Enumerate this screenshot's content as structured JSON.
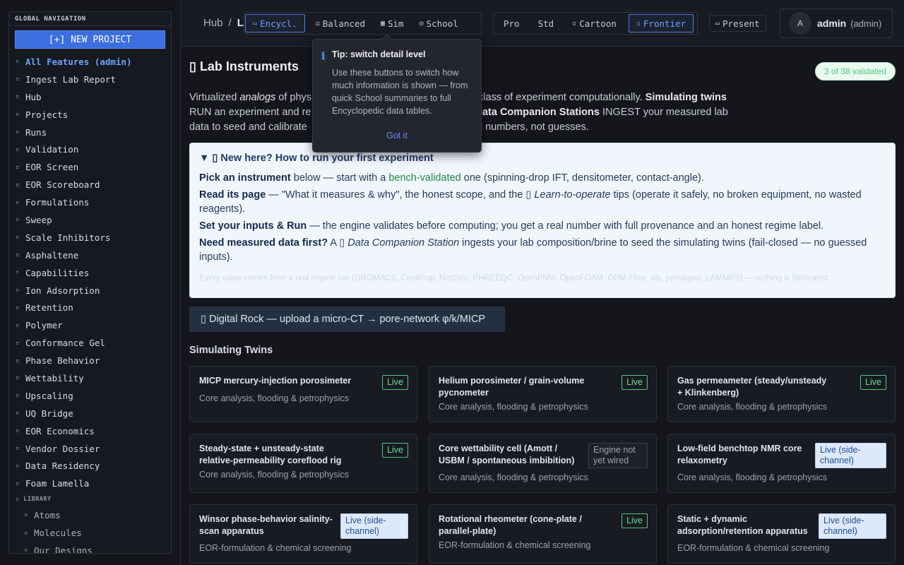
{
  "sidebar": {
    "title": "GLOBAL NAVIGATION",
    "new_project": "[+] NEW PROJECT",
    "items": [
      {
        "bullet": "▫",
        "label": "All Features (admin)"
      },
      {
        "bullet": "▫",
        "label": "Ingest Lab Report"
      },
      {
        "bullet": "▫",
        "label": "Hub"
      },
      {
        "bullet": "▫",
        "label": "Projects"
      },
      {
        "bullet": "▫",
        "label": "Runs"
      },
      {
        "bullet": "▫",
        "label": "Validation"
      },
      {
        "bullet": "▫",
        "label": "EOR Screen"
      },
      {
        "bullet": "▫",
        "label": "EOR Scoreboard"
      },
      {
        "bullet": "▫",
        "label": "Formulations"
      },
      {
        "bullet": "▫",
        "label": "Sweep"
      },
      {
        "bullet": "▫",
        "label": "Scale Inhibitors"
      },
      {
        "bullet": "▫",
        "label": "Asphaltene"
      },
      {
        "bullet": "⚡",
        "label": "Capabilities"
      },
      {
        "bullet": "▫",
        "label": "Ion Adsorption"
      },
      {
        "bullet": "▫",
        "label": "Retention"
      },
      {
        "bullet": "▫",
        "label": "Polymer"
      },
      {
        "bullet": "▫",
        "label": "Conformance Gel"
      },
      {
        "bullet": "▫",
        "label": "Phase Behavior"
      },
      {
        "bullet": "▫",
        "label": "Wettability"
      },
      {
        "bullet": "▫",
        "label": "Upscaling"
      },
      {
        "bullet": "▫",
        "label": "UQ Bridge"
      },
      {
        "bullet": "▫",
        "label": "EOR Economics"
      },
      {
        "bullet": "▫",
        "label": "Vendor Dossier"
      },
      {
        "bullet": "▫",
        "label": "Data Residency"
      },
      {
        "bullet": "▫",
        "label": "Foam Lamella"
      }
    ],
    "library_title": "▫ LIBRARY",
    "library_items": [
      {
        "bullet": "⚛",
        "label": "Atoms"
      },
      {
        "bullet": "▫",
        "label": "Molecules"
      },
      {
        "bullet": "▫",
        "label": "Our Designs"
      }
    ]
  },
  "topbar": {
    "breadcrumb_root": "Hub",
    "breadcrumb_sep": "/",
    "breadcrumb_current": "L",
    "detail_levels": [
      {
        "icon": "▭",
        "label": "Encycl."
      },
      {
        "icon": "⚖",
        "label": "Balanced"
      },
      {
        "icon": "▦",
        "label": "Sim"
      },
      {
        "icon": "◎",
        "label": "School"
      }
    ],
    "styles": [
      {
        "icon": "",
        "label": "Pro"
      },
      {
        "icon": "",
        "label": "Std"
      },
      {
        "icon": "▫",
        "label": "Cartoon"
      },
      {
        "icon": "▫",
        "label": "Frontier"
      }
    ],
    "present": "Present",
    "avatar_letter": "A",
    "user_name": "admin",
    "user_role": "(admin)"
  },
  "tooltip": {
    "icon": "ℹ",
    "title": "Tip: switch detail level",
    "body": "Use these buttons to switch how much information is shown — from quick School summaries to full Encyclopedic data tables.",
    "button": "Got it"
  },
  "main": {
    "title": "▯ Lab Instruments",
    "validated": "3 of 38 validated",
    "intro": {
      "p1": "Virtualized ",
      "p1_em": "analogs",
      "p1b": " of phys",
      "p1c": "class of experiment computationally. ",
      "p1_strong": "Simulating twins",
      "p2": "RUN an experiment and re",
      "p2_strong": "Data Companion Stations",
      "p2b": " INGEST your measured lab",
      "p3": "data to seed and calibrate",
      "p3b": "n real numbers, not guesses."
    },
    "guide": {
      "summary": "▼ ▯ New here? How to run your first experiment",
      "s1_b": "Pick an instrument",
      "s1_a": " below — start with a ",
      "s1_g": "bench-validated",
      "s1_c": " one (spinning-drop IFT, densitometer, contact-angle).",
      "s2_b": "Read its page",
      "s2_a": " — \"What it measures & why\", the honest scope, and the ▯ ",
      "s2_i": "Learn-to-operate",
      "s2_c": " tips (operate it safely, no broken equipment, no wasted reagents).",
      "s3_b": "Set your inputs & Run",
      "s3_a": " — the engine validates before computing; you get a real number with full provenance and an honest regime label.",
      "s4_b": "Need measured data first?",
      "s4_a": " A ▯ ",
      "s4_i": "Data Companion Station",
      "s4_c": " ingests your lab composition/brine to seed the simulating twins (fail-closed — no guessed inputs).",
      "footer": "Every value comes from a real engine run (GROMACS, CoolProp, NeqSim, PHREEQC, OpenPNM, OpenFOAM, OPM-Flow, xtb, pymatgen, LAMMPS) — nothing is fabricated."
    },
    "digital_rock": "▯ Digital Rock — upload a micro-CT → pore-network φ/k/MICP",
    "section_title": "Simulating Twins",
    "cards": [
      {
        "title": "MICP mercury-injection porosimeter",
        "cat": "Core analysis, flooding & petrophysics",
        "badge": "Live",
        "kind": "live"
      },
      {
        "title": "Helium porosimeter / grain-volume pycnometer",
        "cat": "Core analysis, flooding & petrophysics",
        "badge": "Live",
        "kind": "live"
      },
      {
        "title": "Gas permeameter (steady/unsteady + Klinkenberg)",
        "cat": "Core analysis, flooding & petrophysics",
        "badge": "Live",
        "kind": "live"
      },
      {
        "title": "Steady-state + unsteady-state relative-permeability coreflood rig",
        "cat": "Core analysis, flooding & petrophysics",
        "badge": "Live",
        "kind": "live"
      },
      {
        "title": "Core wettability cell (Amott / USBM / spontaneous imbibition)",
        "cat": "Core analysis, flooding & petrophysics",
        "badge": "Engine not yet wired",
        "kind": "off"
      },
      {
        "title": "Low-field benchtop NMR core relaxometry",
        "cat": "Core analysis, flooding & petrophysics",
        "badge": "Live (side-channel)",
        "kind": "side"
      },
      {
        "title": "Winsor phase-behavior salinity-scan apparatus",
        "cat": "EOR-formulation & chemical screening",
        "badge": "Live (side-channel)",
        "kind": "side"
      },
      {
        "title": "Rotational rheometer (cone-plate / parallel-plate)",
        "cat": "EOR-formulation & chemical screening",
        "badge": "Live",
        "kind": "live"
      },
      {
        "title": "Static + dynamic adsorption/retention apparatus",
        "cat": "EOR-formulation & chemical screening",
        "badge": "Live (side-channel)",
        "kind": "side"
      }
    ]
  }
}
